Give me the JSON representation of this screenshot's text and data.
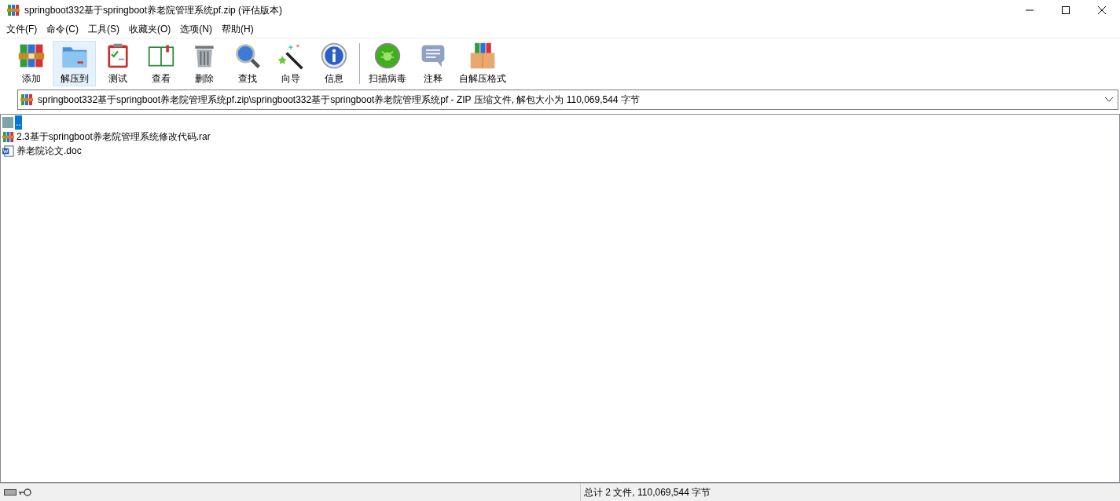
{
  "window": {
    "title": "springboot332基于springboot养老院管理系统pf.zip (评估版本)"
  },
  "menu": [
    "文件(F)",
    "命令(C)",
    "工具(S)",
    "收藏夹(O)",
    "选项(N)",
    "帮助(H)"
  ],
  "toolbar": [
    {
      "kind": "add",
      "label": "添加",
      "selected": false
    },
    {
      "kind": "extract",
      "label": "解压到",
      "selected": true
    },
    {
      "kind": "test",
      "label": "测试",
      "selected": false
    },
    {
      "kind": "view",
      "label": "查看",
      "selected": false
    },
    {
      "kind": "delete",
      "label": "删除",
      "selected": false
    },
    {
      "kind": "find",
      "label": "查找",
      "selected": false
    },
    {
      "kind": "wizard",
      "label": "向导",
      "selected": false
    },
    {
      "kind": "info",
      "label": "信息",
      "selected": false
    },
    {
      "kind": "separator"
    },
    {
      "kind": "scan",
      "label": "扫描病毒",
      "selected": false
    },
    {
      "kind": "comment",
      "label": "注释",
      "selected": false
    },
    {
      "kind": "sfx",
      "label": "自解压格式",
      "selected": false
    }
  ],
  "address": "springboot332基于springboot养老院管理系统pf.zip\\springboot332基于springboot养老院管理系统pf - ZIP 压缩文件, 解包大小为 110,069,544 字节",
  "files": [
    {
      "kind": "up",
      "name": "..",
      "selected": true
    },
    {
      "kind": "rar",
      "name": "2.3基于springboot养老院管理系统修改代码.rar",
      "selected": false
    },
    {
      "kind": "doc",
      "name": "养老院论文.doc",
      "selected": false
    }
  ],
  "status_bar": {
    "total": "总计 2 文件, 110,069,544 字节"
  }
}
